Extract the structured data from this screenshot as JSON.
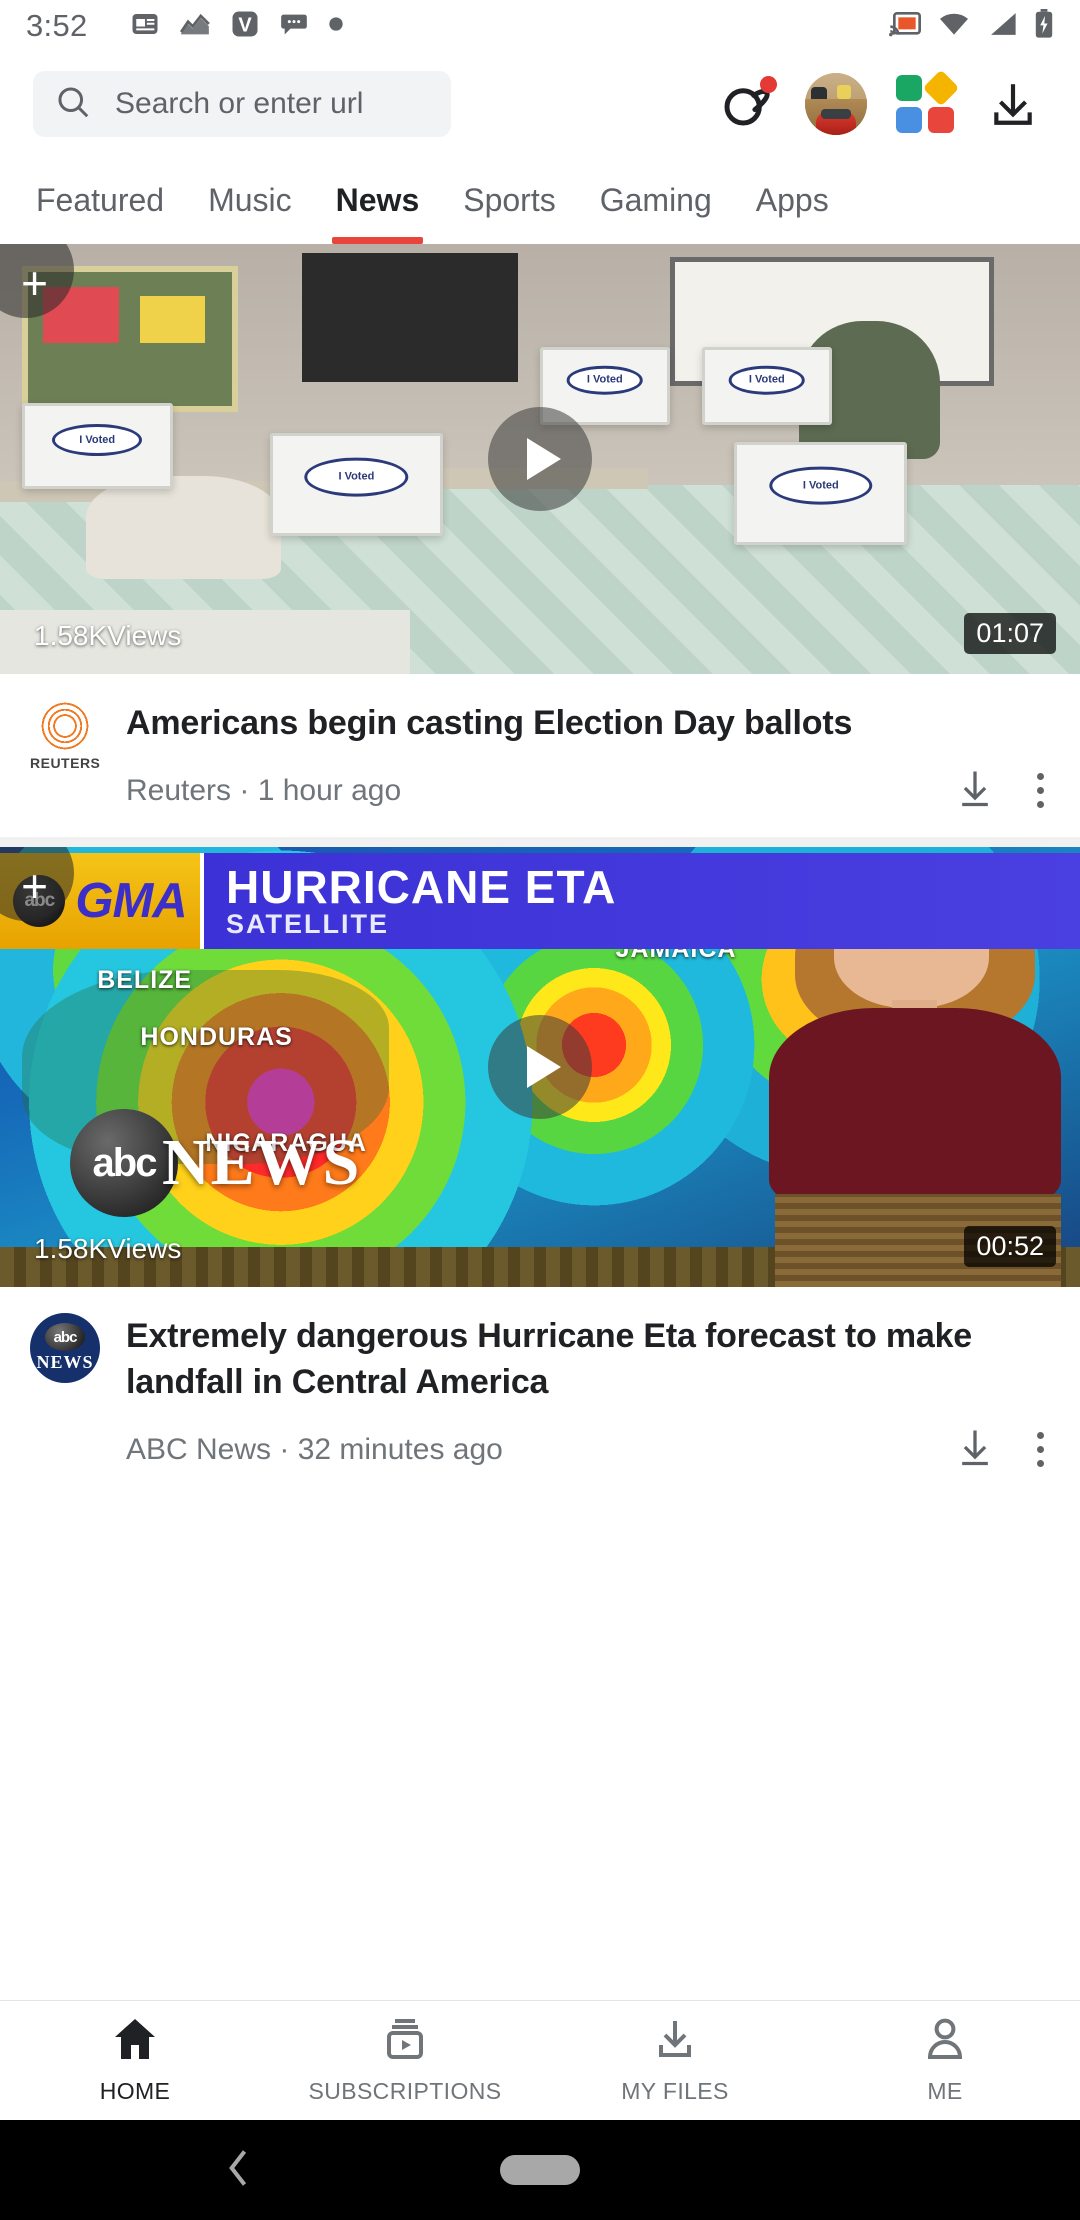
{
  "status_bar": {
    "time": "3:52",
    "left_icons": [
      "news-icon",
      "chart-icon",
      "v-app-icon",
      "chat-bubble-icon",
      "dot-icon"
    ],
    "right_icons": [
      "cast-icon",
      "wifi-icon",
      "cellular-signal-icon",
      "battery-charging-icon"
    ],
    "accent_orange": "#e8562a"
  },
  "toolbar": {
    "search_placeholder": "Search or enter url",
    "search_icon": "search-icon",
    "planet_icon": "planet-icon",
    "planet_badge": "notification-dot",
    "avatar_icon": "user-avatar",
    "apps_icon": "apps-grid-icon",
    "download_icon": "download-icon",
    "apps_colors": [
      "#1aa764",
      "#f5b400",
      "#4a90e2",
      "#e8453c"
    ],
    "badge_color": "#e53935"
  },
  "tabs": {
    "items": [
      {
        "label": "Featured",
        "active": false
      },
      {
        "label": "Music",
        "active": false
      },
      {
        "label": "News",
        "active": true
      },
      {
        "label": "Sports",
        "active": false
      },
      {
        "label": "Gaming",
        "active": false
      },
      {
        "label": "Apps",
        "active": false
      }
    ],
    "indicator_color": "#e8453c"
  },
  "feed": {
    "cards": [
      {
        "id": "card-election",
        "views": "1.58KViews",
        "duration": "01:07",
        "headline": "Americans begin casting Election Day ballots",
        "source": "Reuters",
        "published": "1 hour ago",
        "source_line": "Reuters · 1 hour ago",
        "logo": "reuters-logo",
        "logo_word": "REUTERS",
        "add_icon": "plus-icon",
        "play_icon": "play-icon",
        "download_icon": "download-icon",
        "overflow_icon": "more-vertical-icon",
        "thumbnail_caption": "I Voted"
      },
      {
        "id": "card-hurricane",
        "views": "1.58KViews",
        "duration": "00:52",
        "headline": "Extremely dangerous Hurricane Eta forecast to make landfall in Central America",
        "source": "ABC News",
        "published": "32 minutes ago",
        "source_line": "ABC News · 32 minutes ago",
        "logo": "abc-news-logo",
        "logo_word": "NEWS",
        "add_icon": "plus-icon",
        "play_icon": "play-icon",
        "download_icon": "download-icon",
        "overflow_icon": "more-vertical-icon",
        "banner": {
          "network": "abc",
          "program": "GMA",
          "title": "HURRICANE ETA",
          "subtitle": "SATELLITE"
        },
        "watermark": {
          "network": "abc",
          "text": "NEWS"
        },
        "map_labels": [
          "JAMAICA",
          "BELIZE",
          "HONDURAS",
          "NICARAGUA"
        ]
      }
    ]
  },
  "bottom_nav": {
    "items": [
      {
        "label": "HOME",
        "icon": "home-icon",
        "active": true
      },
      {
        "label": "SUBSCRIPTIONS",
        "icon": "subscriptions-icon",
        "active": false
      },
      {
        "label": "MY FILES",
        "icon": "download-icon",
        "active": false
      },
      {
        "label": "ME",
        "icon": "person-icon",
        "active": false
      }
    ]
  },
  "android_nav": {
    "back_icon": "back-chevron-icon",
    "home_icon": "home-pill-icon"
  }
}
